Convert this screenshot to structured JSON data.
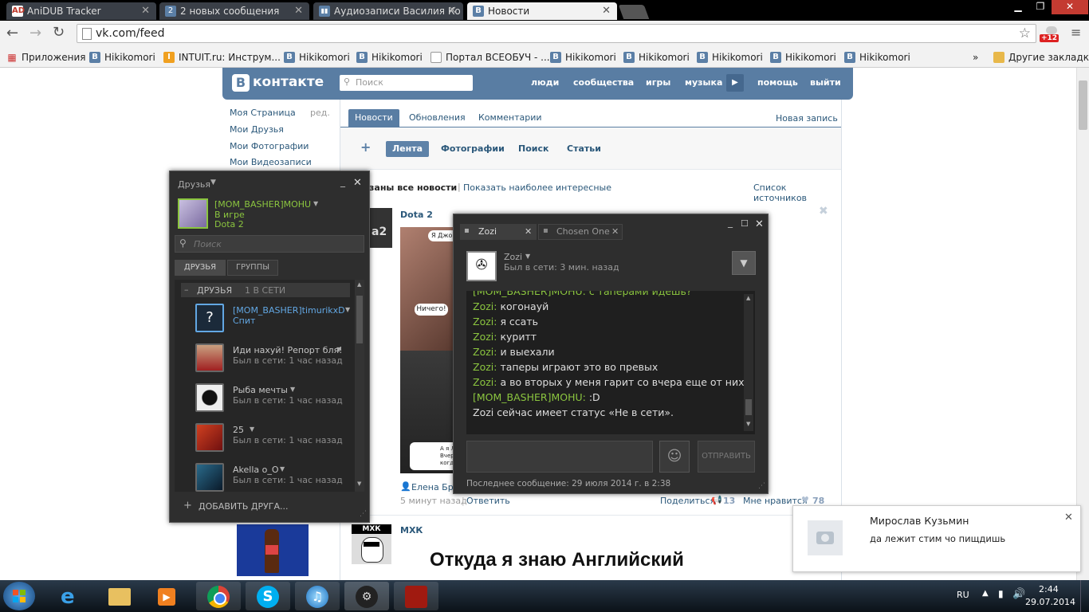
{
  "browser": {
    "tabs": [
      {
        "title": "AniDUB Tracker",
        "icon": "AD",
        "color": "#c0392b"
      },
      {
        "title": "2 новых сообщения",
        "icon": "2",
        "color": "#5b7fa6"
      },
      {
        "title": "Аудиозаписи Василия Ко",
        "icon": "▮▮",
        "color": "#5b7fa6"
      },
      {
        "title": "Новости",
        "icon": "B",
        "color": "#5b7fa6"
      }
    ],
    "url": "vk.com/feed",
    "badge": "+12",
    "bookmarks": [
      "Приложения",
      "Hikikomori",
      "INTUIT.ru: Инструм...",
      "Hikikomori",
      "Hikikomori",
      "Портал ВСЕОБУЧ - ...",
      "Hikikomori",
      "Hikikomori",
      "Hikikomori",
      "Hikikomori",
      "Hikikomori"
    ],
    "more": "»",
    "other_bookmarks": "Другие закладки"
  },
  "vk": {
    "logo": "контакте",
    "search_placeholder": "Поиск",
    "nav": [
      "люди",
      "сообщества",
      "игры",
      "музыка",
      "помощь",
      "выйти"
    ],
    "left_menu": [
      "Моя Страница",
      "Мои Друзья",
      "Мои Фотографии",
      "Мои Видеозаписи"
    ],
    "edit": "ред.",
    "tabs": [
      "Новости",
      "Обновления",
      "Комментарии"
    ],
    "new_post": "Новая запись",
    "subtabs": [
      "Лента",
      "Фотографии",
      "Поиск",
      "Статьи"
    ],
    "filter_shown": "заны все новости",
    "filter_interesting": "Показать наиболее интересные",
    "sources": "Список источников",
    "post1": {
      "title": "Dota 2",
      "bubble1": "Я Джон",
      "bubble2": "Ничего!",
      "bubble3a": "А я Л",
      "bubble3b": "Вчер",
      "bubble3c": "когд",
      "author": "Елена Брос",
      "time": "5 минут назад",
      "reply": "Ответить",
      "share": "Поделиться",
      "share_count": "13",
      "like": "Мне нравится",
      "like_count": "78"
    },
    "post2": {
      "title": "МХК",
      "avatar_text": "МХК",
      "heading": "Откуда я знаю Английский"
    }
  },
  "friends": {
    "title": "Друзья",
    "me": {
      "name": "[MOM_BASHER]MOHU",
      "status": "В игре",
      "game": "Dota 2"
    },
    "search_placeholder": "Поиск",
    "tabs": [
      "ДРУЗЬЯ",
      "ГРУППЫ"
    ],
    "group_label": "ДРУЗЬЯ",
    "group_online": "1 В СЕТИ",
    "list": [
      {
        "name": "[MOM_BASHER]timurikxD",
        "status": "Спит"
      },
      {
        "name": "Иди нахуй! Репорт бля!",
        "status": "Был в сети: 1 час назад"
      },
      {
        "name": "Рыба мечты",
        "status": "Был в сети: 1 час назад"
      },
      {
        "name": "25",
        "status": "Был в сети: 1 час назад"
      },
      {
        "name": "Akella o_O",
        "status": "Был в сети: 1 час назад"
      }
    ],
    "add_friend": "ДОБАВИТЬ ДРУГА..."
  },
  "chat": {
    "tabs": [
      "Zozi",
      "Chosen One"
    ],
    "contact": {
      "name": "Zozi",
      "status": "Был в сети: 3 мин. назад"
    },
    "partial_line": "[MOM_BASHER]MOHU: с таперами  идешь?",
    "messages": [
      {
        "who": "Zozi:",
        "text": " когонауй"
      },
      {
        "who": "Zozi:",
        "text": " я ссать"
      },
      {
        "who": "Zozi:",
        "text": " куритт"
      },
      {
        "who": "Zozi:",
        "text": " и выехали"
      },
      {
        "who": "Zozi:",
        "text": " таперы играют это во превых"
      },
      {
        "who": "Zozi:",
        "text": " а во вторых у меня гарит со вчера еще от них"
      },
      {
        "who": "[MOM_BASHER]MOHU:",
        "text": " :D"
      }
    ],
    "status_note": "Zozi сейчас имеет статус «Не в сети».",
    "send": "ОТПРАВИТЬ",
    "last_message": "Последнее сообщение: 29 июля 2014 г. в 2:38"
  },
  "notification": {
    "name": "Мирослав Кузьмин",
    "text": "да лежит стим чо пищдишь"
  },
  "taskbar": {
    "lang": "RU",
    "time": "2:44",
    "date": "29.07.2014"
  },
  "colors": {
    "vk_blue": "#597da3",
    "steam_green": "#8bc53f",
    "steam_blue": "#62a7e3"
  }
}
